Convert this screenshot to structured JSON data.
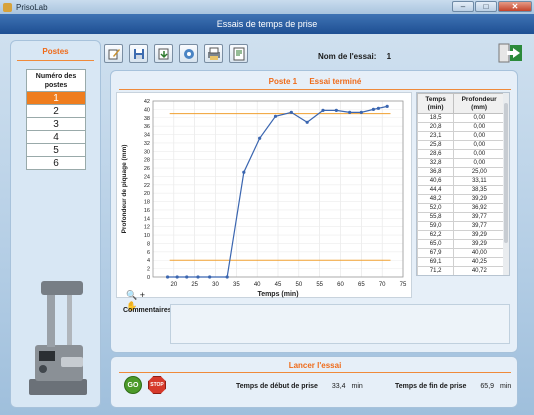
{
  "window": {
    "title": "PrisoLab",
    "min": "–",
    "max": "□",
    "close": "✕"
  },
  "header": {
    "title": "Essais de temps de prise"
  },
  "postes": {
    "title": "Postes",
    "column_header": "Numéro des postes",
    "items": [
      "1",
      "2",
      "3",
      "4",
      "5",
      "6"
    ],
    "selected": "1"
  },
  "toolbar": {
    "icons": [
      "edit-icon",
      "save-icon",
      "export-icon",
      "settings-icon",
      "print-icon",
      "report-icon"
    ],
    "test_name_label": "Nom de l'essai:",
    "test_name_value": "1"
  },
  "status": {
    "poste": "Poste 1",
    "state": "Essai terminé"
  },
  "chart_data": {
    "type": "line",
    "xlabel": "Temps (min)",
    "ylabel": "Profondeur de piquage (mm)",
    "xlim": [
      15,
      75
    ],
    "ylim": [
      0,
      42
    ],
    "xticks": [
      20,
      25,
      30,
      35,
      40,
      45,
      50,
      55,
      60,
      65,
      70,
      75
    ],
    "yticks": [
      0,
      2,
      4,
      6,
      8,
      10,
      12,
      14,
      16,
      18,
      20,
      22,
      24,
      26,
      28,
      30,
      32,
      34,
      36,
      38,
      40,
      42
    ],
    "grid": true,
    "series": [
      {
        "color": "#3b66b0",
        "x": [
          18.5,
          20.8,
          23.1,
          25.8,
          28.6,
          32.8,
          36.8,
          40.6,
          44.4,
          48.2,
          52.0,
          55.8,
          59.0,
          62.2,
          65.0,
          67.9,
          69.1,
          71.2
        ],
        "y": [
          0.0,
          0.0,
          0.0,
          0.0,
          0.0,
          0.0,
          25.0,
          33.11,
          38.35,
          39.29,
          36.92,
          39.77,
          39.77,
          39.29,
          39.29,
          40.0,
          40.25,
          40.72
        ]
      }
    ],
    "reference_lines": [
      {
        "y": 39.0,
        "color": "#f0a030"
      },
      {
        "y": 4.0,
        "color": "#f0a030"
      }
    ]
  },
  "data_table": {
    "headers": [
      "Temps (min)",
      "Profondeur (mm)"
    ],
    "rows": [
      [
        "18,5",
        "0,00"
      ],
      [
        "20,8",
        "0,00"
      ],
      [
        "23,1",
        "0,00"
      ],
      [
        "25,8",
        "0,00"
      ],
      [
        "28,6",
        "0,00"
      ],
      [
        "32,8",
        "0,00"
      ],
      [
        "36,8",
        "25,00"
      ],
      [
        "40,6",
        "33,11"
      ],
      [
        "44,4",
        "38,35"
      ],
      [
        "48,2",
        "39,29"
      ],
      [
        "52,0",
        "36,92"
      ],
      [
        "55,8",
        "39,77"
      ],
      [
        "59,0",
        "39,77"
      ],
      [
        "62,2",
        "39,29"
      ],
      [
        "65,0",
        "39,29"
      ],
      [
        "67,9",
        "40,00"
      ],
      [
        "69,1",
        "40,25"
      ],
      [
        "71,2",
        "40,72"
      ]
    ]
  },
  "zoom_tools": {
    "zoom": "🔍",
    "plus": "+",
    "pan": "✋"
  },
  "comments": {
    "label": "Commentaires :",
    "value": ""
  },
  "launch": {
    "title": "Lancer l'essai",
    "go_label": "GO",
    "stop_label": "STOP",
    "start_label": "Temps de début de prise",
    "start_value": "33,4",
    "start_unit": "min",
    "end_label": "Temps de fin de prise",
    "end_value": "65,9",
    "end_unit": "min"
  }
}
